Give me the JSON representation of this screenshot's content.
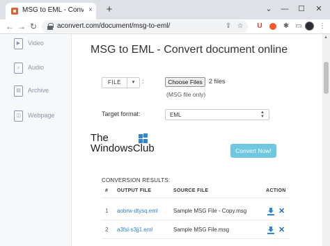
{
  "browser": {
    "tab_title": "MSG to EML - Convert documen",
    "tab_close": "×",
    "new_tab": "+",
    "window": {
      "collapse": "⌄",
      "minimize": "—",
      "maximize": "☐",
      "close": "✕"
    },
    "url": "aconvert.com/document/msg-to-eml/",
    "ext_u_label": "U"
  },
  "sidebar": {
    "items": [
      {
        "label": "Video",
        "icon": "video-file-icon"
      },
      {
        "label": "Audio",
        "icon": "audio-file-icon"
      },
      {
        "label": "Archive",
        "icon": "archive-file-icon"
      },
      {
        "label": "Webpage",
        "icon": "webpage-file-icon"
      }
    ]
  },
  "main": {
    "title": "MSG to EML - Convert document online",
    "source_type": {
      "label": "FILE",
      "caret": "▾",
      "colon": ":"
    },
    "choose_files_label": "Choose Files",
    "files_selected": "2 files",
    "file_note": "(MSG file only)",
    "target_format_label": "Target format:",
    "target_format_value": "EML",
    "convert_button": "Convert Now!",
    "results_heading": "CONVERSION RESULTS:"
  },
  "watermark": {
    "line1": "The",
    "line2": "WindowsClub"
  },
  "results_table": {
    "headers": [
      "#",
      "OUTPUT FILE",
      "SOURCE FILE",
      "ACTION"
    ],
    "rows": [
      {
        "num": "1",
        "output": "aobrw-dtysq.eml",
        "source": "Sample MSG File - Copy.msg"
      },
      {
        "num": "2",
        "output": "a3fsl-s3jj1.eml",
        "source": "Sample MSG File.msg"
      }
    ]
  },
  "colors": {
    "link": "#2e7fc8",
    "convert_button": "#6dc8e0",
    "action_icon": "#2e86cf"
  }
}
